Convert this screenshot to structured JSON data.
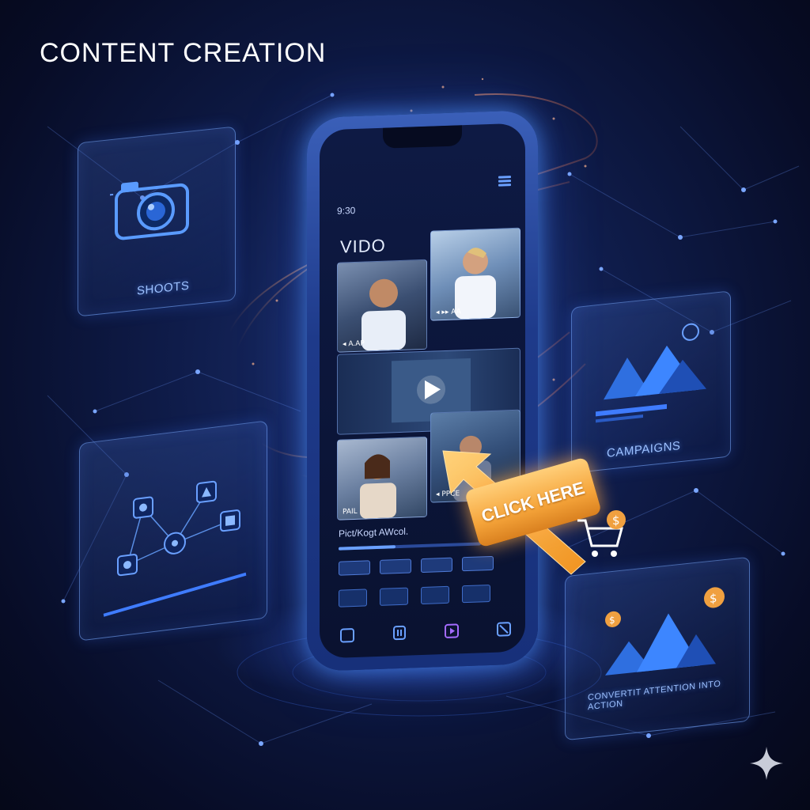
{
  "header": {
    "title": "CONTENT CREATION"
  },
  "panels": {
    "shoots": {
      "label": "SHOOTS"
    },
    "campaigns": {
      "label": "CAMPAIGNS"
    },
    "convert": {
      "label": "CONVERTIT ATTENTION INTO ACTION"
    }
  },
  "phone": {
    "time": "9:30",
    "section_title": "VIDO",
    "caption": "Pict/Kogt AWcol.",
    "thumb_tags": [
      "◂ A.AP",
      "◂ ▸▸ AA",
      "PAIL",
      "◂ PPCE"
    ]
  },
  "cta": {
    "label": "CLICK HERE"
  },
  "icons": {
    "camera": "camera-icon",
    "cart": "shopping-cart-icon",
    "dollar": "dollar-coin-icon",
    "play": "play-icon",
    "sparkle": "sparkle-icon"
  },
  "colors": {
    "accent": "#4f8bff",
    "cta": "#f5a43a",
    "background": "#0b1438"
  }
}
